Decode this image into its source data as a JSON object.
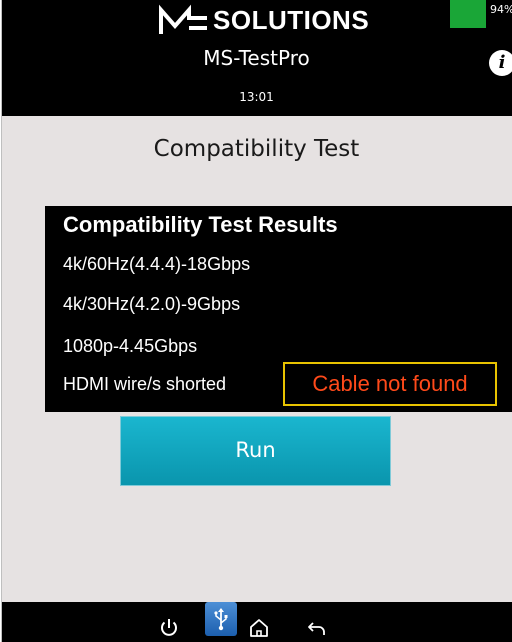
{
  "header": {
    "logo_text": "SOLUTIONS",
    "model_name": "MS-TestPro",
    "time": "13:01",
    "battery_percent": "94%",
    "battery_color": "#1aa637"
  },
  "page": {
    "title": "Compatibility Test"
  },
  "results": {
    "heading": "Compatibility Test Results",
    "items": [
      "4k/60Hz(4.4.4)-18Gbps",
      "4k/30Hz(4.2.0)-9Gbps",
      "1080p-4.45Gbps",
      "HDMI wire/s shorted"
    ],
    "status": "Cable not found",
    "status_color": "#ff4a1a",
    "status_border_color": "#e8c300"
  },
  "actions": {
    "run_label": "Run",
    "run_color": "#1ab6cf"
  },
  "nav": {
    "icons": [
      "power-icon",
      "usb-icon",
      "home-icon",
      "back-arrow-icon"
    ]
  }
}
